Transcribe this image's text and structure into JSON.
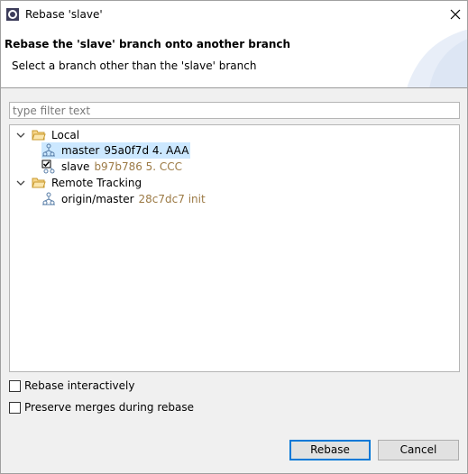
{
  "window": {
    "title": "Rebase 'slave'"
  },
  "banner": {
    "title": "Rebase the 'slave' branch onto another branch",
    "subtitle": "Select a branch other than the 'slave' branch"
  },
  "filter": {
    "placeholder": "type filter text",
    "value": ""
  },
  "tree": {
    "local": {
      "label": "Local",
      "items": [
        {
          "name": "master",
          "detail": "95a0f7d 4. AAA",
          "selected": true
        },
        {
          "name": "slave",
          "detail": "b97b786 5. CCC",
          "checked_out": true
        }
      ]
    },
    "remote": {
      "label": "Remote Tracking",
      "items": [
        {
          "name": "origin/master",
          "detail": "28c7dc7 init"
        }
      ]
    }
  },
  "options": {
    "interactive": {
      "label": "Rebase interactively",
      "checked": false
    },
    "preserve_merges": {
      "label": "Preserve merges during rebase",
      "checked": false
    }
  },
  "buttons": {
    "rebase": "Rebase",
    "cancel": "Cancel"
  },
  "colors": {
    "selection": "#cce8ff",
    "detail_text": "#9c7a45",
    "primary_border": "#0078d7"
  }
}
